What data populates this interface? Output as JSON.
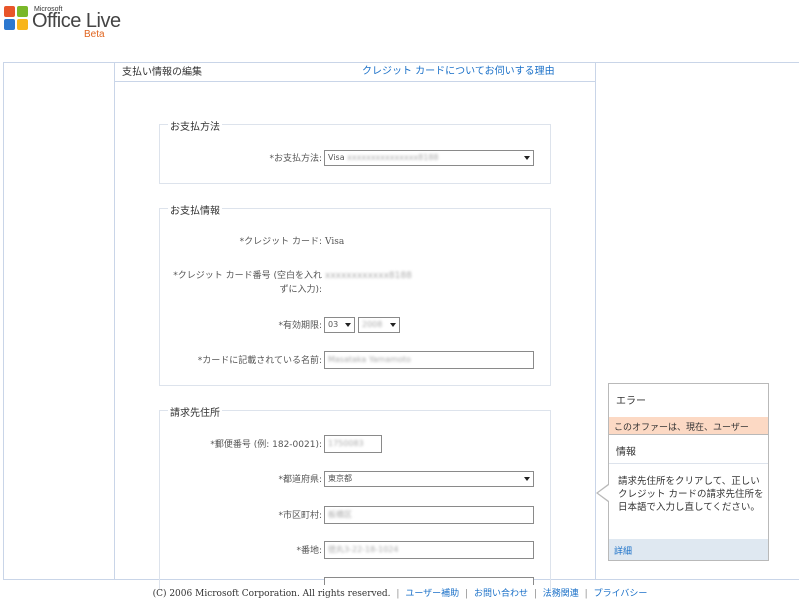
{
  "brand": {
    "ms": "Microsoft",
    "name": "Office Live",
    "beta": "Beta"
  },
  "header": {
    "title": "支払い情報の編集",
    "why_link": "クレジット カードについてお伺いする理由"
  },
  "payment_method": {
    "legend": "お支払方法",
    "label": "*お支払方法:",
    "value_prefix": "Visa",
    "value_masked": "xxxxxxxxxxxxxxx8188"
  },
  "payment_info": {
    "legend": "お支払情報",
    "card_type_label": "*クレジット カード:",
    "card_type_value": "Visa",
    "card_number_label_1": "*クレジット カード番号 (空白を入れ",
    "card_number_label_2": "ずに入力):",
    "card_number_value": "xxxxxxxxxxxx8188",
    "expiry_label": "*有効期限:",
    "expiry_month": "03",
    "expiry_year": "2008",
    "name_label": "*カードに記載されている名前:",
    "name_value": "Masataka Yamamoto"
  },
  "billing_address": {
    "legend": "請求先住所",
    "postal_label": "*郵便番号 (例: 182-0021):",
    "postal_value": "1750083",
    "prefecture_label": "*都道府県:",
    "prefecture_value": "東京都",
    "city_label": "*市区町村:",
    "city_value": "板橋区",
    "street_label": "*番地:",
    "street_value": "徳丸3-22-18-1024"
  },
  "error_popup": {
    "title": "エラー",
    "message": "このオファーは、現在、ユーザー"
  },
  "info_popup": {
    "title": "情報",
    "body": "請求先住所をクリアして、正しいクレジット カードの請求先住所を日本語で入力し直してください。",
    "more_link": "詳細"
  },
  "footer": {
    "copyright": "(C) 2006 Microsoft Corporation. All rights reserved.",
    "links": [
      "ユーザー補助",
      "お問い合わせ",
      "法務関連",
      "プライバシー"
    ],
    "separator": "|"
  },
  "colors": {
    "link": "#1a70c8",
    "error_bar": "#fcd9c4",
    "info_footer": "#dfe8f1",
    "beta": "#e0641e"
  }
}
